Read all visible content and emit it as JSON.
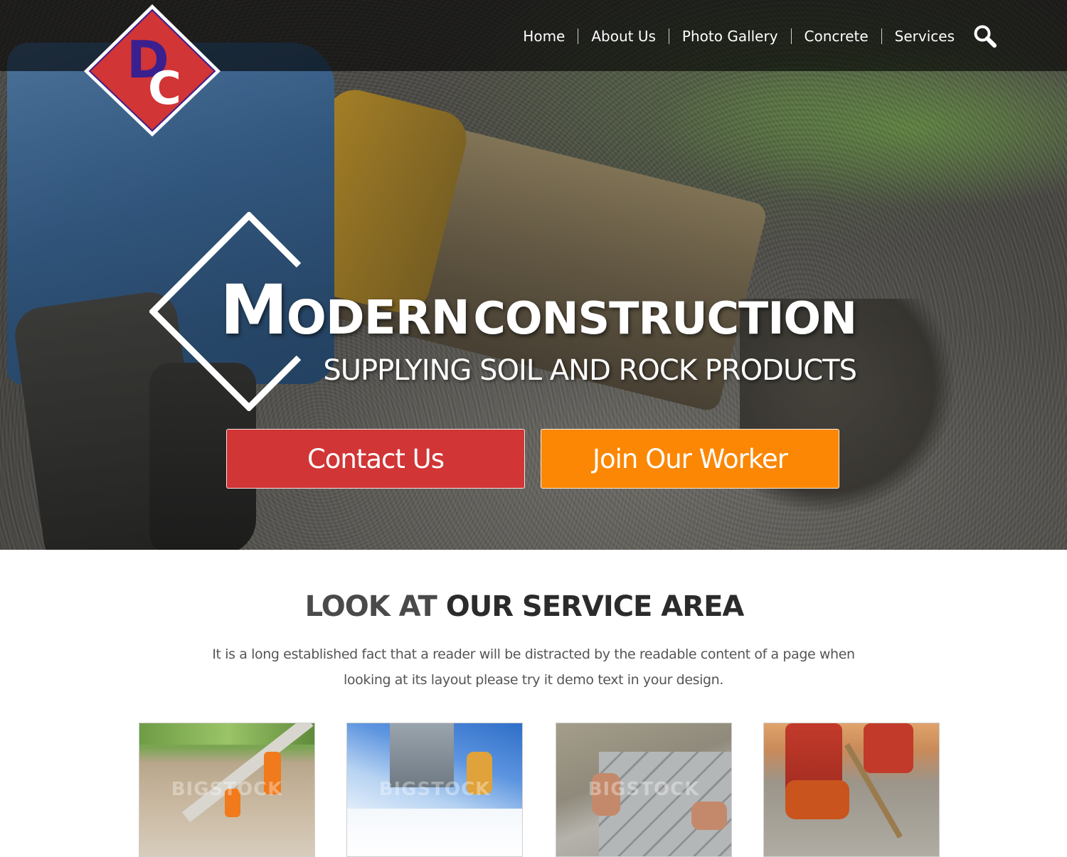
{
  "brand": {
    "logo_letters": "DC",
    "colors": {
      "logo_red": "#d13536",
      "logo_blue": "#3a1f8f"
    }
  },
  "nav": {
    "items": [
      {
        "label": "Home"
      },
      {
        "label": "About Us"
      },
      {
        "label": "Photo Gallery"
      },
      {
        "label": "Concrete"
      },
      {
        "label": "Services"
      }
    ],
    "search_icon": "search-icon"
  },
  "hero": {
    "title_big": "M",
    "title_mid": "ODERN",
    "title_rest": "CONSTRUCTION",
    "subtitle": "SUPPLYING SOIL AND ROCK PRODUCTS",
    "buttons": {
      "contact": {
        "label": "Contact Us",
        "color": "#d13536"
      },
      "join": {
        "label": "Join Our Worker",
        "color": "#fb8705"
      }
    }
  },
  "service_area": {
    "title_light": "LOOK AT",
    "title_strong": "OUR SERVICE AREA",
    "text": "It is a long established fact that a reader will be distracted by the readable content of a page when looking at its layout please try it demo text in your design.",
    "thumbnails": [
      {
        "watermark": "BIGSTOCK"
      },
      {
        "watermark": "BIGSTOCK"
      },
      {
        "watermark": "BIGSTOCK"
      },
      {
        "watermark": ""
      }
    ]
  }
}
